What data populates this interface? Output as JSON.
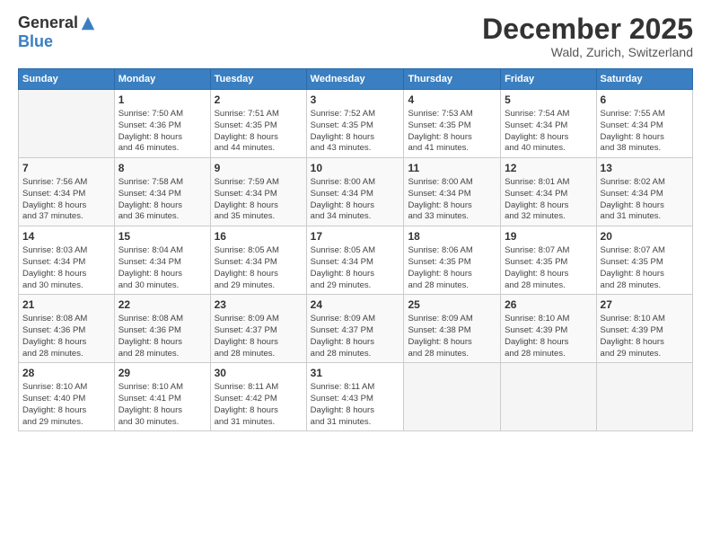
{
  "logo": {
    "general": "General",
    "blue": "Blue"
  },
  "title": "December 2025",
  "location": "Wald, Zurich, Switzerland",
  "days_header": [
    "Sunday",
    "Monday",
    "Tuesday",
    "Wednesday",
    "Thursday",
    "Friday",
    "Saturday"
  ],
  "weeks": [
    [
      {
        "day": "",
        "info": ""
      },
      {
        "day": "1",
        "info": "Sunrise: 7:50 AM\nSunset: 4:36 PM\nDaylight: 8 hours\nand 46 minutes."
      },
      {
        "day": "2",
        "info": "Sunrise: 7:51 AM\nSunset: 4:35 PM\nDaylight: 8 hours\nand 44 minutes."
      },
      {
        "day": "3",
        "info": "Sunrise: 7:52 AM\nSunset: 4:35 PM\nDaylight: 8 hours\nand 43 minutes."
      },
      {
        "day": "4",
        "info": "Sunrise: 7:53 AM\nSunset: 4:35 PM\nDaylight: 8 hours\nand 41 minutes."
      },
      {
        "day": "5",
        "info": "Sunrise: 7:54 AM\nSunset: 4:34 PM\nDaylight: 8 hours\nand 40 minutes."
      },
      {
        "day": "6",
        "info": "Sunrise: 7:55 AM\nSunset: 4:34 PM\nDaylight: 8 hours\nand 38 minutes."
      }
    ],
    [
      {
        "day": "7",
        "info": "Sunrise: 7:56 AM\nSunset: 4:34 PM\nDaylight: 8 hours\nand 37 minutes."
      },
      {
        "day": "8",
        "info": "Sunrise: 7:58 AM\nSunset: 4:34 PM\nDaylight: 8 hours\nand 36 minutes."
      },
      {
        "day": "9",
        "info": "Sunrise: 7:59 AM\nSunset: 4:34 PM\nDaylight: 8 hours\nand 35 minutes."
      },
      {
        "day": "10",
        "info": "Sunrise: 8:00 AM\nSunset: 4:34 PM\nDaylight: 8 hours\nand 34 minutes."
      },
      {
        "day": "11",
        "info": "Sunrise: 8:00 AM\nSunset: 4:34 PM\nDaylight: 8 hours\nand 33 minutes."
      },
      {
        "day": "12",
        "info": "Sunrise: 8:01 AM\nSunset: 4:34 PM\nDaylight: 8 hours\nand 32 minutes."
      },
      {
        "day": "13",
        "info": "Sunrise: 8:02 AM\nSunset: 4:34 PM\nDaylight: 8 hours\nand 31 minutes."
      }
    ],
    [
      {
        "day": "14",
        "info": "Sunrise: 8:03 AM\nSunset: 4:34 PM\nDaylight: 8 hours\nand 30 minutes."
      },
      {
        "day": "15",
        "info": "Sunrise: 8:04 AM\nSunset: 4:34 PM\nDaylight: 8 hours\nand 30 minutes."
      },
      {
        "day": "16",
        "info": "Sunrise: 8:05 AM\nSunset: 4:34 PM\nDaylight: 8 hours\nand 29 minutes."
      },
      {
        "day": "17",
        "info": "Sunrise: 8:05 AM\nSunset: 4:34 PM\nDaylight: 8 hours\nand 29 minutes."
      },
      {
        "day": "18",
        "info": "Sunrise: 8:06 AM\nSunset: 4:35 PM\nDaylight: 8 hours\nand 28 minutes."
      },
      {
        "day": "19",
        "info": "Sunrise: 8:07 AM\nSunset: 4:35 PM\nDaylight: 8 hours\nand 28 minutes."
      },
      {
        "day": "20",
        "info": "Sunrise: 8:07 AM\nSunset: 4:35 PM\nDaylight: 8 hours\nand 28 minutes."
      }
    ],
    [
      {
        "day": "21",
        "info": "Sunrise: 8:08 AM\nSunset: 4:36 PM\nDaylight: 8 hours\nand 28 minutes."
      },
      {
        "day": "22",
        "info": "Sunrise: 8:08 AM\nSunset: 4:36 PM\nDaylight: 8 hours\nand 28 minutes."
      },
      {
        "day": "23",
        "info": "Sunrise: 8:09 AM\nSunset: 4:37 PM\nDaylight: 8 hours\nand 28 minutes."
      },
      {
        "day": "24",
        "info": "Sunrise: 8:09 AM\nSunset: 4:37 PM\nDaylight: 8 hours\nand 28 minutes."
      },
      {
        "day": "25",
        "info": "Sunrise: 8:09 AM\nSunset: 4:38 PM\nDaylight: 8 hours\nand 28 minutes."
      },
      {
        "day": "26",
        "info": "Sunrise: 8:10 AM\nSunset: 4:39 PM\nDaylight: 8 hours\nand 28 minutes."
      },
      {
        "day": "27",
        "info": "Sunrise: 8:10 AM\nSunset: 4:39 PM\nDaylight: 8 hours\nand 29 minutes."
      }
    ],
    [
      {
        "day": "28",
        "info": "Sunrise: 8:10 AM\nSunset: 4:40 PM\nDaylight: 8 hours\nand 29 minutes."
      },
      {
        "day": "29",
        "info": "Sunrise: 8:10 AM\nSunset: 4:41 PM\nDaylight: 8 hours\nand 30 minutes."
      },
      {
        "day": "30",
        "info": "Sunrise: 8:11 AM\nSunset: 4:42 PM\nDaylight: 8 hours\nand 31 minutes."
      },
      {
        "day": "31",
        "info": "Sunrise: 8:11 AM\nSunset: 4:43 PM\nDaylight: 8 hours\nand 31 minutes."
      },
      {
        "day": "",
        "info": ""
      },
      {
        "day": "",
        "info": ""
      },
      {
        "day": "",
        "info": ""
      }
    ]
  ]
}
